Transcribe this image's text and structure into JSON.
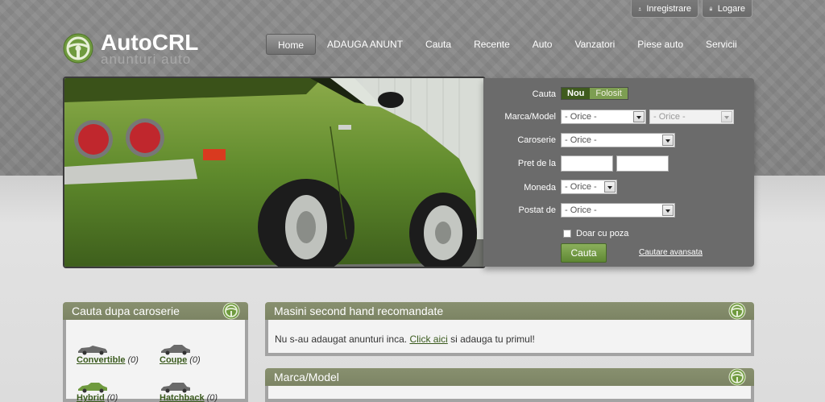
{
  "account": {
    "register_label": "Inregistrare",
    "login_label": "Logare"
  },
  "logo": {
    "name": "AutoCRL",
    "tagline": "anunturi auto"
  },
  "nav": {
    "items": [
      {
        "label": "Home",
        "active": true
      },
      {
        "label": "ADAUGA ANUNT",
        "active": false
      },
      {
        "label": "Cauta",
        "active": false
      },
      {
        "label": "Recente",
        "active": false
      },
      {
        "label": "Auto",
        "active": false
      },
      {
        "label": "Vanzatori",
        "active": false
      },
      {
        "label": "Piese auto",
        "active": false
      },
      {
        "label": "Servicii",
        "active": false
      }
    ]
  },
  "search": {
    "cauta_label": "Cauta",
    "toggle_new": "Nou",
    "toggle_used": "Folosit",
    "marca_label": "Marca/Model",
    "marca_value": "- Orice -",
    "model_value": "- Orice -",
    "caroserie_label": "Caroserie",
    "caroserie_value": "- Orice -",
    "pret_label": "Pret de la",
    "moneda_label": "Moneda",
    "moneda_value": "- Orice -",
    "postat_label": "Postat de",
    "postat_value": "- Orice -",
    "photo_only_label": "Doar cu poza",
    "submit_label": "Cauta",
    "advanced_link": "Cautare avansata"
  },
  "body_types": {
    "title": "Cauta dupa caroserie",
    "items": [
      {
        "label": "Convertible",
        "count": "(0)"
      },
      {
        "label": "Coupe",
        "count": "(0)"
      },
      {
        "label": "Hybrid",
        "count": "(0)"
      },
      {
        "label": "Hatchback",
        "count": "(0)"
      }
    ]
  },
  "recommended": {
    "title": "Masini second hand recomandate",
    "message_before": "Nu s-au adaugat anunturi inca. ",
    "link_text": "Click aici",
    "message_after": " si adauga tu primul!"
  },
  "marca_box": {
    "title": "Marca/Model"
  },
  "colors": {
    "accent_green": "#6f9a3e",
    "box_header": "#838b6b",
    "nav_text": "#ffffff"
  }
}
